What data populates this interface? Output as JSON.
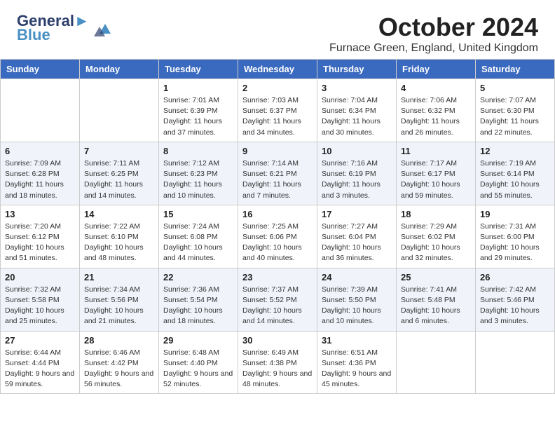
{
  "logo": {
    "line1": "General",
    "line2": "Blue",
    "icon_alt": "GeneralBlue logo"
  },
  "title": "October 2024",
  "subtitle": "Furnace Green, England, United Kingdom",
  "weekdays": [
    "Sunday",
    "Monday",
    "Tuesday",
    "Wednesday",
    "Thursday",
    "Friday",
    "Saturday"
  ],
  "weeks": [
    [
      {
        "day": "",
        "sunrise": "",
        "sunset": "",
        "daylight": ""
      },
      {
        "day": "",
        "sunrise": "",
        "sunset": "",
        "daylight": ""
      },
      {
        "day": "1",
        "sunrise": "Sunrise: 7:01 AM",
        "sunset": "Sunset: 6:39 PM",
        "daylight": "Daylight: 11 hours and 37 minutes."
      },
      {
        "day": "2",
        "sunrise": "Sunrise: 7:03 AM",
        "sunset": "Sunset: 6:37 PM",
        "daylight": "Daylight: 11 hours and 34 minutes."
      },
      {
        "day": "3",
        "sunrise": "Sunrise: 7:04 AM",
        "sunset": "Sunset: 6:34 PM",
        "daylight": "Daylight: 11 hours and 30 minutes."
      },
      {
        "day": "4",
        "sunrise": "Sunrise: 7:06 AM",
        "sunset": "Sunset: 6:32 PM",
        "daylight": "Daylight: 11 hours and 26 minutes."
      },
      {
        "day": "5",
        "sunrise": "Sunrise: 7:07 AM",
        "sunset": "Sunset: 6:30 PM",
        "daylight": "Daylight: 11 hours and 22 minutes."
      }
    ],
    [
      {
        "day": "6",
        "sunrise": "Sunrise: 7:09 AM",
        "sunset": "Sunset: 6:28 PM",
        "daylight": "Daylight: 11 hours and 18 minutes."
      },
      {
        "day": "7",
        "sunrise": "Sunrise: 7:11 AM",
        "sunset": "Sunset: 6:25 PM",
        "daylight": "Daylight: 11 hours and 14 minutes."
      },
      {
        "day": "8",
        "sunrise": "Sunrise: 7:12 AM",
        "sunset": "Sunset: 6:23 PM",
        "daylight": "Daylight: 11 hours and 10 minutes."
      },
      {
        "day": "9",
        "sunrise": "Sunrise: 7:14 AM",
        "sunset": "Sunset: 6:21 PM",
        "daylight": "Daylight: 11 hours and 7 minutes."
      },
      {
        "day": "10",
        "sunrise": "Sunrise: 7:16 AM",
        "sunset": "Sunset: 6:19 PM",
        "daylight": "Daylight: 11 hours and 3 minutes."
      },
      {
        "day": "11",
        "sunrise": "Sunrise: 7:17 AM",
        "sunset": "Sunset: 6:17 PM",
        "daylight": "Daylight: 10 hours and 59 minutes."
      },
      {
        "day": "12",
        "sunrise": "Sunrise: 7:19 AM",
        "sunset": "Sunset: 6:14 PM",
        "daylight": "Daylight: 10 hours and 55 minutes."
      }
    ],
    [
      {
        "day": "13",
        "sunrise": "Sunrise: 7:20 AM",
        "sunset": "Sunset: 6:12 PM",
        "daylight": "Daylight: 10 hours and 51 minutes."
      },
      {
        "day": "14",
        "sunrise": "Sunrise: 7:22 AM",
        "sunset": "Sunset: 6:10 PM",
        "daylight": "Daylight: 10 hours and 48 minutes."
      },
      {
        "day": "15",
        "sunrise": "Sunrise: 7:24 AM",
        "sunset": "Sunset: 6:08 PM",
        "daylight": "Daylight: 10 hours and 44 minutes."
      },
      {
        "day": "16",
        "sunrise": "Sunrise: 7:25 AM",
        "sunset": "Sunset: 6:06 PM",
        "daylight": "Daylight: 10 hours and 40 minutes."
      },
      {
        "day": "17",
        "sunrise": "Sunrise: 7:27 AM",
        "sunset": "Sunset: 6:04 PM",
        "daylight": "Daylight: 10 hours and 36 minutes."
      },
      {
        "day": "18",
        "sunrise": "Sunrise: 7:29 AM",
        "sunset": "Sunset: 6:02 PM",
        "daylight": "Daylight: 10 hours and 32 minutes."
      },
      {
        "day": "19",
        "sunrise": "Sunrise: 7:31 AM",
        "sunset": "Sunset: 6:00 PM",
        "daylight": "Daylight: 10 hours and 29 minutes."
      }
    ],
    [
      {
        "day": "20",
        "sunrise": "Sunrise: 7:32 AM",
        "sunset": "Sunset: 5:58 PM",
        "daylight": "Daylight: 10 hours and 25 minutes."
      },
      {
        "day": "21",
        "sunrise": "Sunrise: 7:34 AM",
        "sunset": "Sunset: 5:56 PM",
        "daylight": "Daylight: 10 hours and 21 minutes."
      },
      {
        "day": "22",
        "sunrise": "Sunrise: 7:36 AM",
        "sunset": "Sunset: 5:54 PM",
        "daylight": "Daylight: 10 hours and 18 minutes."
      },
      {
        "day": "23",
        "sunrise": "Sunrise: 7:37 AM",
        "sunset": "Sunset: 5:52 PM",
        "daylight": "Daylight: 10 hours and 14 minutes."
      },
      {
        "day": "24",
        "sunrise": "Sunrise: 7:39 AM",
        "sunset": "Sunset: 5:50 PM",
        "daylight": "Daylight: 10 hours and 10 minutes."
      },
      {
        "day": "25",
        "sunrise": "Sunrise: 7:41 AM",
        "sunset": "Sunset: 5:48 PM",
        "daylight": "Daylight: 10 hours and 6 minutes."
      },
      {
        "day": "26",
        "sunrise": "Sunrise: 7:42 AM",
        "sunset": "Sunset: 5:46 PM",
        "daylight": "Daylight: 10 hours and 3 minutes."
      }
    ],
    [
      {
        "day": "27",
        "sunrise": "Sunrise: 6:44 AM",
        "sunset": "Sunset: 4:44 PM",
        "daylight": "Daylight: 9 hours and 59 minutes."
      },
      {
        "day": "28",
        "sunrise": "Sunrise: 6:46 AM",
        "sunset": "Sunset: 4:42 PM",
        "daylight": "Daylight: 9 hours and 56 minutes."
      },
      {
        "day": "29",
        "sunrise": "Sunrise: 6:48 AM",
        "sunset": "Sunset: 4:40 PM",
        "daylight": "Daylight: 9 hours and 52 minutes."
      },
      {
        "day": "30",
        "sunrise": "Sunrise: 6:49 AM",
        "sunset": "Sunset: 4:38 PM",
        "daylight": "Daylight: 9 hours and 48 minutes."
      },
      {
        "day": "31",
        "sunrise": "Sunrise: 6:51 AM",
        "sunset": "Sunset: 4:36 PM",
        "daylight": "Daylight: 9 hours and 45 minutes."
      },
      {
        "day": "",
        "sunrise": "",
        "sunset": "",
        "daylight": ""
      },
      {
        "day": "",
        "sunrise": "",
        "sunset": "",
        "daylight": ""
      }
    ]
  ]
}
